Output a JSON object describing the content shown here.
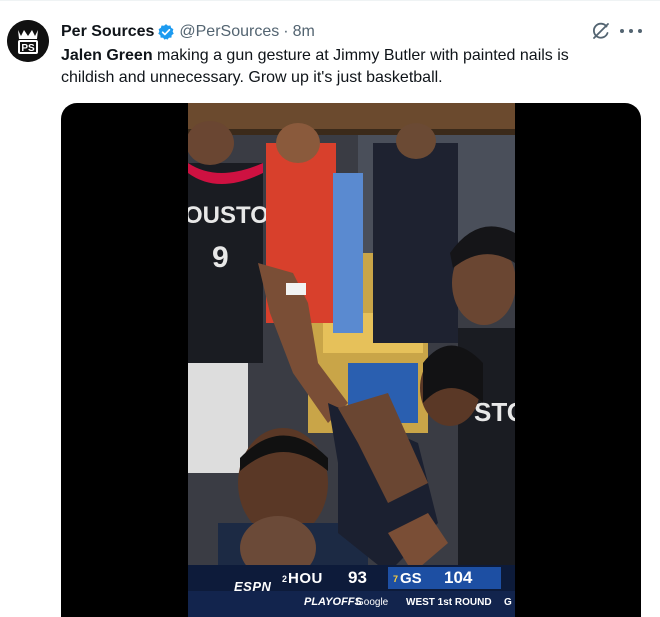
{
  "tweet": {
    "author": {
      "display_name": "Per Sources",
      "handle": "@PerSources",
      "separator": "·",
      "timestamp": "8m",
      "verified": true,
      "avatar_text": "PS",
      "verified_color": "#1d9bf0"
    },
    "text": {
      "bold_name": "Jalen Green",
      "body": " making a gun gesture at Jimmy Butler with painted nails is childish and unnecessary. Grow up it's just basketball."
    },
    "icons": {
      "verified": "verified-badge-icon",
      "grok": "grok-icon",
      "more": "more-options-icon"
    },
    "media": {
      "type": "video",
      "jersey_text": "OUSTON",
      "jersey_number": "9",
      "jersey_text_right": "STO",
      "scoreboard": {
        "network": "ESPN",
        "team1_seed": "2",
        "team1": "HOU",
        "team1_score": "93",
        "team2_seed": "7",
        "team2": "GS",
        "team2_score": "104",
        "event": "PLAYOFFS",
        "sponsor": "Google",
        "round": "WEST 1st ROUND",
        "ticker": "G"
      }
    }
  }
}
